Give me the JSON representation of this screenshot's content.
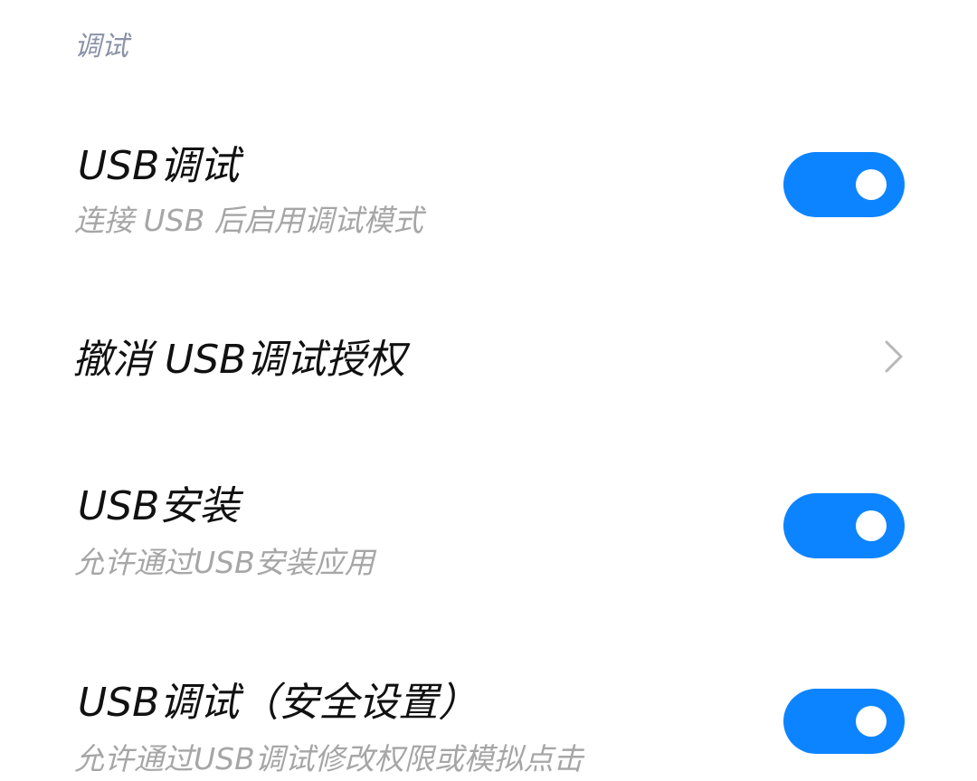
{
  "section": {
    "header": "调试"
  },
  "rows": [
    {
      "title": "USB调试",
      "subtitle": "连接 USB 后启用调试模式",
      "control": "toggle",
      "enabled": true
    },
    {
      "title": "撤消 USB调试授权",
      "control": "chevron",
      "icon": "chevron-right-icon"
    },
    {
      "title": "USB安装",
      "subtitle": "允许通过USB安装应用",
      "control": "toggle",
      "enabled": true
    },
    {
      "title": "USB调试（安全设置）",
      "subtitle": "允许通过USB调试修改权限或模拟点击",
      "control": "toggle",
      "enabled": true
    }
  ],
  "colors": {
    "accent": "#0d84ff",
    "title_text": "#111111",
    "subtitle_text": "#a6a6a6",
    "header_text": "#8a93a6",
    "chevron": "#b8b8b8"
  }
}
